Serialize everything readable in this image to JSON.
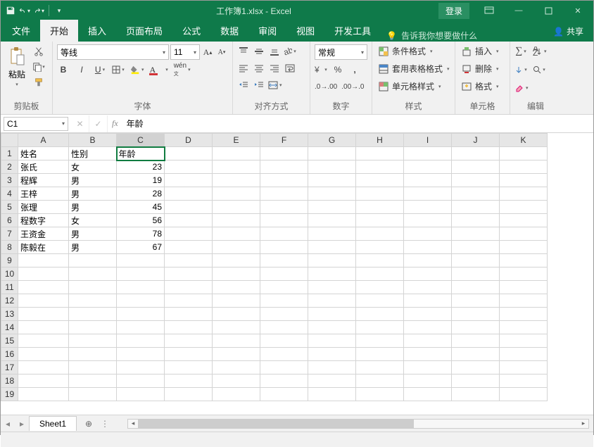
{
  "title": "工作簿1.xlsx - Excel",
  "login": "登录",
  "menu": {
    "file": "文件",
    "home": "开始",
    "insert": "插入",
    "layout": "页面布局",
    "formula": "公式",
    "data": "数据",
    "review": "审阅",
    "view": "视图",
    "dev": "开发工具",
    "tellme": "告诉我你想要做什么",
    "share": "共享"
  },
  "namebox": "C1",
  "fx": "年龄",
  "font": {
    "name": "等线",
    "size": "11"
  },
  "numfmt": "常规",
  "groups": {
    "clipboard": "剪贴板",
    "font": "字体",
    "align": "对齐方式",
    "number": "数字",
    "styles": "样式",
    "cells": "单元格",
    "editing": "编辑"
  },
  "paste": "粘贴",
  "styles": {
    "cond": "条件格式",
    "table": "套用表格格式",
    "cell": "单元格样式"
  },
  "cells": {
    "insert": "插入",
    "delete": "删除",
    "format": "格式"
  },
  "sheettab": "Sheet1",
  "cols": [
    "A",
    "B",
    "C",
    "D",
    "E",
    "F",
    "G",
    "H",
    "I",
    "J",
    "K"
  ],
  "rows": [
    1,
    2,
    3,
    4,
    5,
    6,
    7,
    8,
    9,
    10,
    11,
    12,
    13,
    14,
    15,
    16,
    17,
    18,
    19
  ],
  "data": [
    [
      "姓名",
      "性别",
      "年龄"
    ],
    [
      "张氏",
      "女",
      "23"
    ],
    [
      "程辉",
      "男",
      "19"
    ],
    [
      "王梓",
      "男",
      "28"
    ],
    [
      "张理",
      "男",
      "45"
    ],
    [
      "程数字",
      "女",
      "56"
    ],
    [
      "王资金",
      "男",
      "78"
    ],
    [
      "陈毅在",
      "男",
      "67"
    ]
  ]
}
